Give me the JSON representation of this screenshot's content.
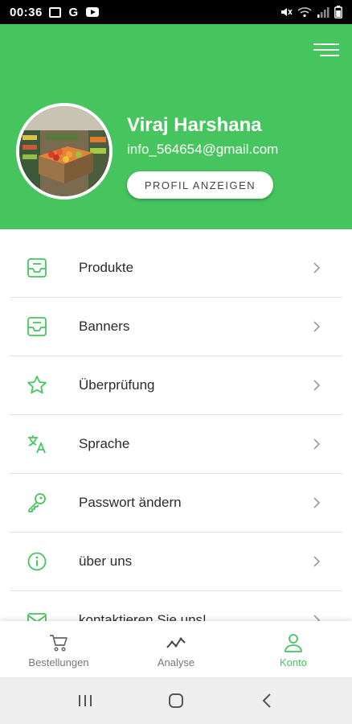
{
  "status_bar": {
    "time": "00:36",
    "left_icons": [
      "image-icon",
      "google-icon",
      "youtube-icon"
    ],
    "right_icons": [
      "mute-icon",
      "wifi-icon",
      "signal-icon",
      "battery-icon"
    ]
  },
  "header": {
    "background_color": "#46c55f",
    "menu_icon": "hamburger-menu-icon",
    "profile": {
      "name": "Viraj Harshana",
      "email": "info_564654@gmail.com",
      "button_label": "PROFIL ANZEIGEN",
      "avatar": "grocery-store-photo"
    }
  },
  "menu": {
    "items": [
      {
        "label": "Produkte",
        "icon": "inbox-tray-icon"
      },
      {
        "label": "Banners",
        "icon": "inbox-tray-icon"
      },
      {
        "label": "Überprüfung",
        "icon": "star-icon"
      },
      {
        "label": "Sprache",
        "icon": "translate-icon"
      },
      {
        "label": "Passwort ändern",
        "icon": "key-icon"
      },
      {
        "label": "über uns",
        "icon": "info-icon"
      },
      {
        "label": "kontaktieren Sie uns!",
        "icon": "mail-icon"
      }
    ],
    "chevron_icon": "chevron-right-icon"
  },
  "bottom_nav": {
    "items": [
      {
        "label": "Bestellungen",
        "icon": "cart-icon",
        "active": false
      },
      {
        "label": "Analyse",
        "icon": "trend-line-icon",
        "active": false
      },
      {
        "label": "Konto",
        "icon": "user-icon",
        "active": true
      }
    ],
    "active_color": "#46c55f",
    "inactive_color": "#777777"
  },
  "system_nav": {
    "buttons": [
      "recents-icon",
      "home-icon",
      "back-icon"
    ]
  }
}
